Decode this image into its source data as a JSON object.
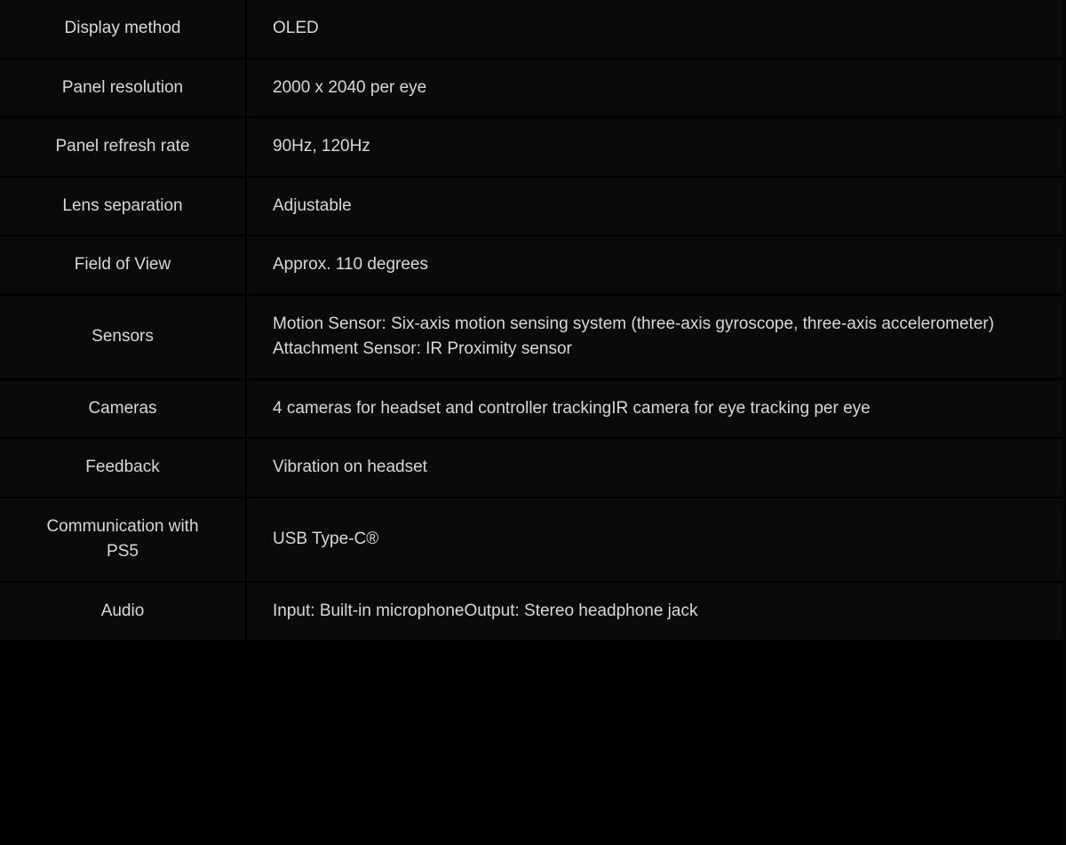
{
  "table": {
    "name": "vr-headset-specifications",
    "rows": [
      {
        "label": "Display method",
        "value_lines": [
          "OLED"
        ]
      },
      {
        "label": "Panel resolution",
        "value_lines": [
          "2000 x 2040 per eye"
        ]
      },
      {
        "label": "Panel refresh rate",
        "value_lines": [
          "90Hz, 120Hz"
        ]
      },
      {
        "label": "Lens separation",
        "value_lines": [
          "Adjustable"
        ]
      },
      {
        "label": "Field of View",
        "value_lines": [
          "Approx. 110 degrees"
        ]
      },
      {
        "label": "Sensors",
        "value_lines": [
          "Motion Sensor: Six-axis motion sensing system (three-axis gyroscope, three-axis accelerometer)",
          "Attachment Sensor: IR Proximity sensor"
        ]
      },
      {
        "label": "Cameras",
        "value_lines": [
          "4 cameras for headset and controller trackingIR camera for eye tracking per eye"
        ]
      },
      {
        "label": "Feedback",
        "value_lines": [
          "Vibration on headset"
        ]
      },
      {
        "label": "Communication with PS5",
        "value_lines": [
          "USB Type-C®"
        ]
      },
      {
        "label": "Audio",
        "value_lines": [
          "Input: Built-in microphoneOutput: Stereo headphone jack"
        ]
      }
    ]
  },
  "colors": {
    "background": "#000000",
    "row_background": "#0a0a0a",
    "divider": "#000000",
    "text": "#d8d8d8"
  }
}
